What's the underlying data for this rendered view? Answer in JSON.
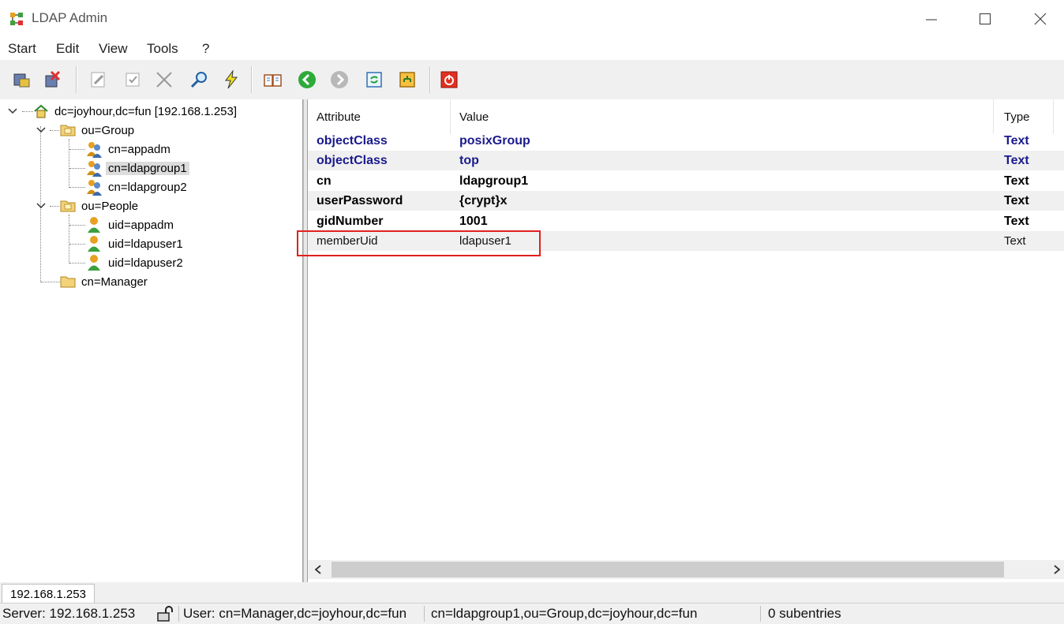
{
  "window": {
    "title": "LDAP Admin"
  },
  "menu": [
    "Start",
    "Edit",
    "View",
    "Tools",
    "?"
  ],
  "toolbar": {
    "buttons": [
      "connect-icon",
      "disconnect-icon",
      "edit-icon",
      "properties-icon",
      "delete-icon",
      "search-icon",
      "lightning-icon",
      "schema-book-icon",
      "back-icon",
      "forward-icon",
      "refresh-icon",
      "tree-icon",
      "exit-icon"
    ]
  },
  "tree": {
    "root": "dc=joyhour,dc=fun [192.168.1.253]",
    "group_ou": "ou=Group",
    "groups": [
      "cn=appadm",
      "cn=ldapgroup1",
      "cn=ldapgroup2"
    ],
    "selected_group": "cn=ldapgroup1",
    "people_ou": "ou=People",
    "people": [
      "uid=appadm",
      "uid=ldapuser1",
      "uid=ldapuser2"
    ],
    "manager": "cn=Manager"
  },
  "attributes": {
    "columns": [
      "Attribute",
      "Value",
      "Type"
    ],
    "rows": [
      {
        "attribute": "objectClass",
        "value": "posixGroup",
        "type": "Text"
      },
      {
        "attribute": "objectClass",
        "value": "top",
        "type": "Text"
      },
      {
        "attribute": "cn",
        "value": "ldapgroup1",
        "type": "Text"
      },
      {
        "attribute": "userPassword",
        "value": "{crypt}x",
        "type": "Text"
      },
      {
        "attribute": "gidNumber",
        "value": "1001",
        "type": "Text"
      },
      {
        "attribute": "memberUid",
        "value": "ldapuser1",
        "type": "Text"
      }
    ]
  },
  "tabs": {
    "server": "192.168.1.253"
  },
  "status": {
    "server": "Server: 192.168.1.253",
    "user": "User: cn=Manager,dc=joyhour,dc=fun",
    "dn": "cn=ldapgroup1,ou=Group,dc=joyhour,dc=fun",
    "subentries": "0 subentries"
  },
  "colors": {
    "highlight": "#e02020",
    "objectclass_text": "#1a1a8c"
  }
}
